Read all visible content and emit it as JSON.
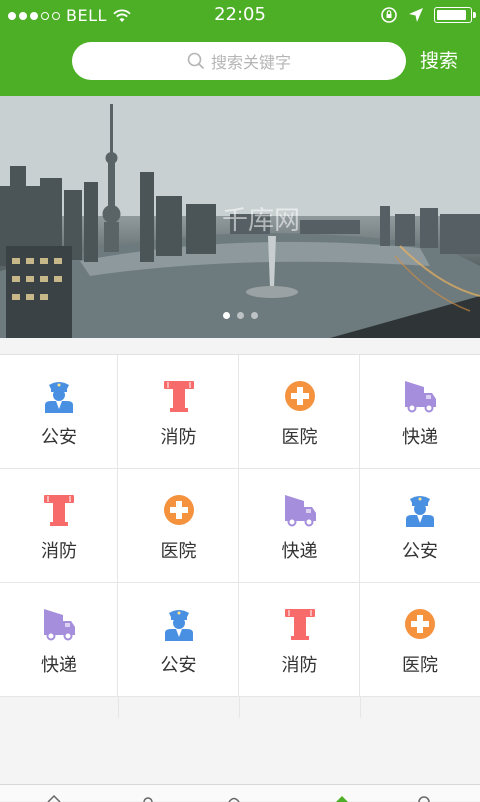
{
  "status_bar": {
    "carrier": "BELL",
    "time": "22:05",
    "battery_level": 0.95
  },
  "search": {
    "placeholder": "搜索关键字",
    "button_label": "搜索"
  },
  "banner": {
    "watermark": "千库网",
    "page_count": 3,
    "active_page": 1
  },
  "grid": {
    "items": [
      {
        "label": "公安",
        "icon": "police-icon"
      },
      {
        "label": "消防",
        "icon": "hydrant-icon"
      },
      {
        "label": "医院",
        "icon": "hospital-icon"
      },
      {
        "label": "快递",
        "icon": "truck-icon"
      },
      {
        "label": "消防",
        "icon": "hydrant-icon"
      },
      {
        "label": "医院",
        "icon": "hospital-icon"
      },
      {
        "label": "快递",
        "icon": "truck-icon"
      },
      {
        "label": "公安",
        "icon": "police-icon"
      },
      {
        "label": "快递",
        "icon": "truck-icon"
      },
      {
        "label": "公安",
        "icon": "police-icon"
      },
      {
        "label": "消防",
        "icon": "hydrant-icon"
      },
      {
        "label": "医院",
        "icon": "hospital-icon"
      }
    ]
  },
  "colors": {
    "header_green": "#4caf25",
    "police_blue": "#4a90e2",
    "hydrant_red": "#f76b6b",
    "hospital_orange": "#f5923e",
    "truck_purple": "#a58fdc"
  }
}
